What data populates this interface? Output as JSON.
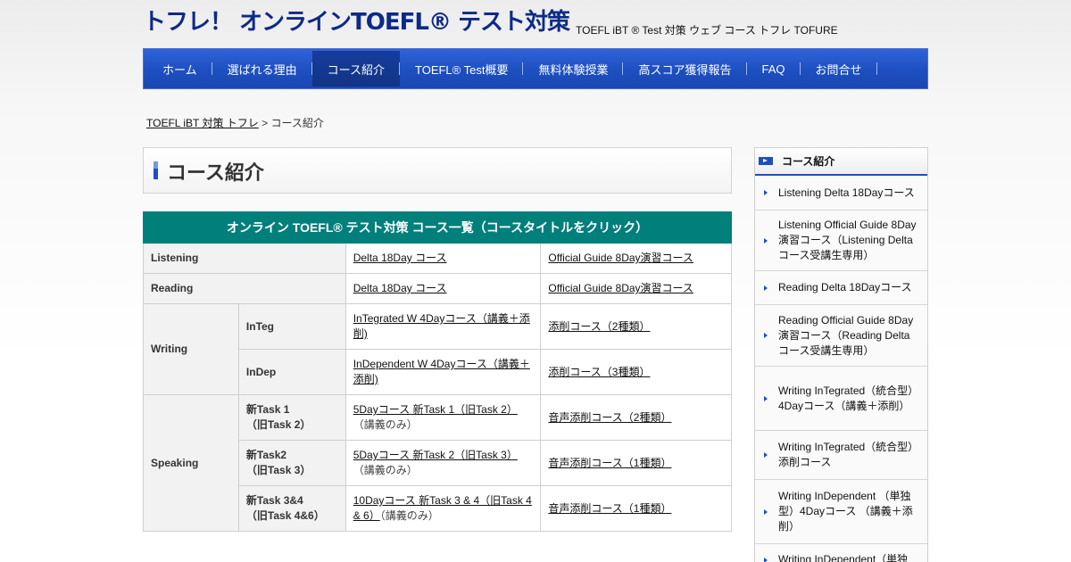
{
  "header": {
    "logo": "トフレ！ オンラインTOEFL® テスト対策",
    "tagline": "TOEFL iBT ® Test 対策 ウェブ コース トフレ TOFURE"
  },
  "nav": {
    "items": [
      {
        "label": "ホーム"
      },
      {
        "label": "選ばれる理由"
      },
      {
        "label": "コース紹介"
      },
      {
        "label": "TOEFL® Test概要"
      },
      {
        "label": "無料体験授業"
      },
      {
        "label": "高スコア獲得報告"
      },
      {
        "label": "FAQ"
      },
      {
        "label": "お問合せ"
      }
    ],
    "active": "コース紹介"
  },
  "breadcrumb": {
    "home": "TOEFL iBT 対策 トフレ",
    "separator": " > ",
    "current": "コース紹介"
  },
  "page": {
    "title": "コース紹介"
  },
  "table": {
    "heading": "オンライン TOEFL® テスト対策 コース一覧（コースタイトルをクリック）",
    "listening": {
      "label": "Listening",
      "course1": "Delta 18Day コース",
      "course2": "Official Guide 8Day演習コース"
    },
    "reading": {
      "label": "Reading",
      "course1": "Delta 18Day コース",
      "course2": "Official Guide 8Day演習コース"
    },
    "writing": {
      "label": "Writing",
      "integ": {
        "label": "InTeg",
        "course1": "InTegrated W 4Dayコース（講義＋添削)",
        "course2": "添削コース（2種類）"
      },
      "indep": {
        "label": "InDep",
        "course1": "InDependent W 4Dayコース（講義＋添削)",
        "course2": "添削コース（3種類）"
      }
    },
    "speaking": {
      "label": "Speaking",
      "task1": {
        "label1": "新Task 1",
        "label2": "（旧Task 2）",
        "course1": "5Dayコース 新Task 1（旧Task 2）",
        "note": "（講義のみ）",
        "course2": "音声添削コース（2種類）"
      },
      "task2": {
        "label1": "新Task2",
        "label2": "（旧Task 3）",
        "course1": "5Dayコース 新Task 2（旧Task 3）",
        "note": "（講義のみ）",
        "course2": "音声添削コース（1種類）"
      },
      "task34": {
        "label1": "新Task 3&4",
        "label2": "（旧Task 4&6）",
        "course1": "10Dayコース 新Task 3 & 4（旧Task 4 & 6）",
        "note": "（講義のみ）",
        "course2": "音声添削コース（1種類）"
      }
    }
  },
  "sidebar": {
    "heading": "コース紹介",
    "items": [
      {
        "label": "Listening Delta 18Dayコース"
      },
      {
        "label": "Listening Official Guide 8Day演習コース（Listening Deltaコース受講生専用）"
      },
      {
        "label": "Reading Delta 18Dayコース"
      },
      {
        "label": "Reading Official Guide 8Day演習コース（Reading Deltaコース受講生専用）"
      },
      {
        "label": "Writing InTegrated（統合型）4Dayコース（講義＋添削）"
      },
      {
        "label": "Writing InTegrated（統合型）添削コース"
      },
      {
        "label": "Writing InDependent （単独型）4Dayコース （講義＋添削）"
      },
      {
        "label": "Writing InDependent（単独"
      }
    ]
  },
  "colors": {
    "nav_blue": "#1d4fc0",
    "table_header_teal": "#007f7b",
    "logo_navy": "#0d2a87"
  }
}
